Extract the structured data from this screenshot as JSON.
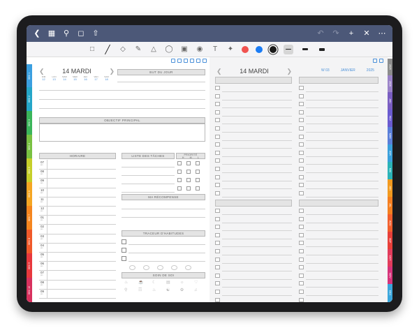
{
  "navbar": {
    "icons": [
      "back-icon",
      "grid-icon",
      "search-icon",
      "bookmark-icon",
      "share-icon"
    ],
    "right_icons": [
      "undo-icon",
      "redo-icon",
      "add-icon",
      "close-icon",
      "more-icon"
    ]
  },
  "toolbar": {
    "tools": [
      "lasso-icon",
      "pen-icon",
      "eraser-icon",
      "highlighter-icon",
      "shapes-icon",
      "lasso-select-icon",
      "image-icon",
      "camera-icon",
      "text-icon",
      "laser-icon"
    ],
    "colors": [
      "#f0524f",
      "#1a7cf5",
      "#1a1a1a"
    ]
  },
  "left_tabs": [
    "SEC 1",
    "SEC 2",
    "SEC 3",
    "SEC 4",
    "SEC 5",
    "SEC 6",
    "SEC 7",
    "SEC 8",
    "SEC 9",
    "SEC 10"
  ],
  "right_tabs": [
    "2025",
    "2026",
    "JAN",
    "FEV",
    "MAR",
    "AVR",
    "MAI",
    "JUN",
    "JUL",
    "AOU",
    "SEP",
    "OCT",
    "NOV",
    "DEC"
  ],
  "left_page": {
    "date_title": "14 MARDI",
    "week_days": [
      {
        "name": "DIM",
        "num": "12"
      },
      {
        "name": "LUN",
        "num": "13"
      },
      {
        "name": "MAR",
        "num": "14"
      },
      {
        "name": "MER",
        "num": "15"
      },
      {
        "name": "JEU",
        "num": "16"
      },
      {
        "name": "VEN",
        "num": "17"
      },
      {
        "name": "SAM",
        "num": "18"
      }
    ],
    "but_du_jour": "BUT DU JOUR",
    "objectif": "OBJECTIF PRINCIPAL",
    "horaire": "HORAIRE",
    "liste_taches": "LISTE DES TÂCHES",
    "priorite": "PRIORITÉ",
    "priorite_levels": [
      "H",
      "M",
      "L"
    ],
    "recompense": "MA RÉCOMPENSE",
    "habitudes": "TRACEUR D'HABITUDES",
    "soin": "SOIN DE SOI",
    "hours": [
      {
        "h": "07",
        "p": "am"
      },
      {
        "h": "08",
        "p": "am"
      },
      {
        "h": "09",
        "p": "am"
      },
      {
        "h": "10",
        "p": "am"
      },
      {
        "h": "11",
        "p": "am"
      },
      {
        "h": "12",
        "p": "pm"
      },
      {
        "h": "01",
        "p": "pm"
      },
      {
        "h": "02",
        "p": "pm"
      },
      {
        "h": "03",
        "p": "pm"
      },
      {
        "h": "04",
        "p": "pm"
      },
      {
        "h": "05",
        "p": "pm"
      },
      {
        "h": "06",
        "p": "pm"
      },
      {
        "h": "07",
        "p": "pm"
      },
      {
        "h": "08",
        "p": "pm"
      },
      {
        "h": "09",
        "p": "pm"
      }
    ]
  },
  "right_page": {
    "date_title": "14 MARDI",
    "breadcrumb_week": "W 03",
    "breadcrumb_month": "JANVIER",
    "breadcrumb_year": "2025"
  }
}
